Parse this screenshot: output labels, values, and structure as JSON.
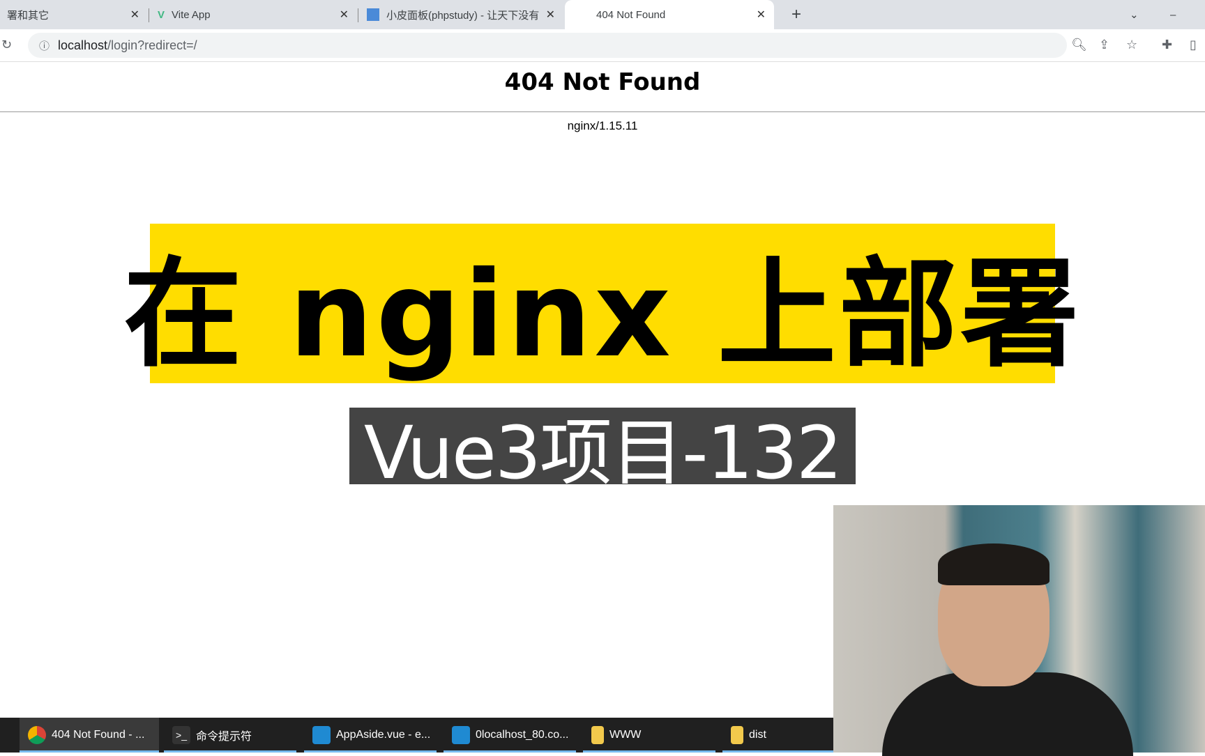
{
  "browser": {
    "tabs": [
      {
        "title": "署和其它",
        "active": false
      },
      {
        "title": "Vite App",
        "active": false
      },
      {
        "title": "小皮面板(phpstudy) - 让天下没有",
        "active": false
      },
      {
        "title": "404 Not Found",
        "active": true
      }
    ],
    "new_tab": "+",
    "url_host": "localhost",
    "url_path": "/login?redirect=/"
  },
  "page": {
    "heading": "404 Not Found",
    "server": "nginx/1.15.11"
  },
  "overlay": {
    "title": "在 nginx 上部署",
    "subtitle": "Vue3项目-132",
    "title_bg": "#ffdd00",
    "subtitle_bg": "#444444"
  },
  "taskbar": {
    "items": [
      {
        "label": "404 Not Found - ...",
        "icon": "chrome-icon"
      },
      {
        "label": "命令提示符",
        "icon": "terminal-icon"
      },
      {
        "label": "AppAside.vue - e...",
        "icon": "vscode-icon"
      },
      {
        "label": "0localhost_80.co...",
        "icon": "vscode-icon"
      },
      {
        "label": "WWW",
        "icon": "folder-icon"
      },
      {
        "label": "dist",
        "icon": "folder-icon"
      }
    ]
  }
}
